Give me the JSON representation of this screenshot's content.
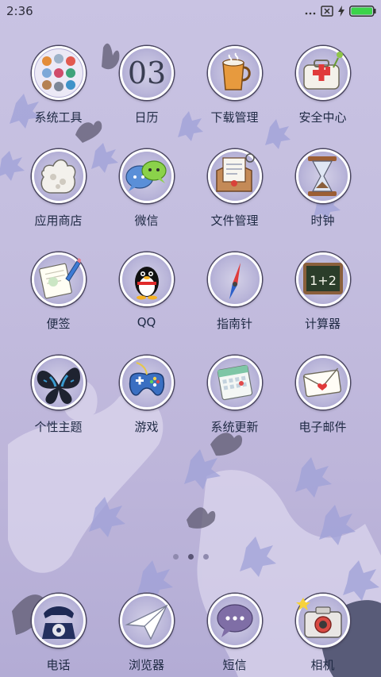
{
  "status_bar": {
    "time": "2:36",
    "icons": [
      "signal-dots-icon",
      "no-sim-icon",
      "charging-bolt-icon",
      "battery-icon"
    ],
    "battery_color": "#3bd44a"
  },
  "apps": [
    {
      "label": "系统工具",
      "icon": "tools-folder-icon"
    },
    {
      "label": "日历",
      "icon": "calendar-icon",
      "icon_text": "03"
    },
    {
      "label": "下载管理",
      "icon": "download-cup-icon"
    },
    {
      "label": "安全中心",
      "icon": "first-aid-kit-icon"
    },
    {
      "label": "应用商店",
      "icon": "shopping-bag-icon"
    },
    {
      "label": "微信",
      "icon": "wechat-bubbles-icon"
    },
    {
      "label": "文件管理",
      "icon": "file-envelope-icon"
    },
    {
      "label": "时钟",
      "icon": "hourglass-icon"
    },
    {
      "label": "便签",
      "icon": "notepad-pencil-icon"
    },
    {
      "label": "QQ",
      "icon": "qq-penguin-icon"
    },
    {
      "label": "指南针",
      "icon": "compass-needle-icon"
    },
    {
      "label": "计算器",
      "icon": "chalkboard-icon",
      "icon_text": "1+2"
    },
    {
      "label": "个性主题",
      "icon": "butterfly-icon"
    },
    {
      "label": "游戏",
      "icon": "gamepad-icon"
    },
    {
      "label": "系统更新",
      "icon": "calendar-update-icon"
    },
    {
      "label": "电子邮件",
      "icon": "envelope-heart-icon"
    }
  ],
  "page_indicator": {
    "count": 3,
    "active": 2
  },
  "dock": [
    {
      "label": "电话",
      "icon": "rotary-phone-icon"
    },
    {
      "label": "浏览器",
      "icon": "paper-plane-icon"
    },
    {
      "label": "短信",
      "icon": "speech-bubble-icon"
    },
    {
      "label": "相机",
      "icon": "camera-icon"
    }
  ],
  "colors": {
    "label": "#1f2a44",
    "background": "#c4bedf"
  }
}
